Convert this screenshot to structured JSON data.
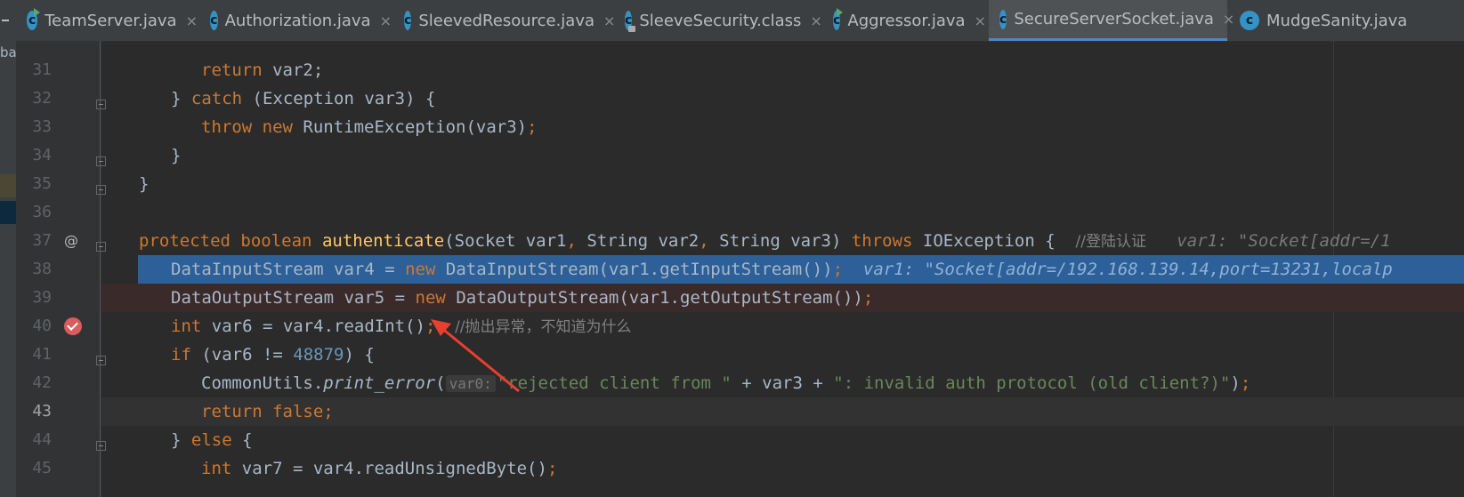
{
  "sidebar": {
    "partial_label": "ba"
  },
  "tabs": [
    {
      "label": "TeamServer.java",
      "icon": "class-run-icon",
      "close": "×"
    },
    {
      "label": "Authorization.java",
      "icon": "class-icon",
      "close": "×"
    },
    {
      "label": "SleevedResource.java",
      "icon": "class-icon",
      "close": "×"
    },
    {
      "label": "SleeveSecurity.class",
      "icon": "class-locked-icon",
      "close": "×"
    },
    {
      "label": "Aggressor.java",
      "icon": "class-run-icon",
      "close": "×"
    },
    {
      "label": "SecureServerSocket.java",
      "icon": "class-icon",
      "close": "×",
      "active": true
    },
    {
      "label": "MudgeSanity.java",
      "icon": "class-icon",
      "close": ""
    }
  ],
  "editor": {
    "lines": [
      {
        "n": "31"
      },
      {
        "n": "32"
      },
      {
        "n": "33"
      },
      {
        "n": "34"
      },
      {
        "n": "35"
      },
      {
        "n": "36"
      },
      {
        "n": "37"
      },
      {
        "n": "38"
      },
      {
        "n": "39"
      },
      {
        "n": "40"
      },
      {
        "n": "41"
      },
      {
        "n": "42"
      },
      {
        "n": "43"
      },
      {
        "n": "44"
      },
      {
        "n": "45"
      }
    ],
    "code": {
      "l31_ret": "return",
      "l31_var": " var2;",
      "l32_open": "} ",
      "l32_catch": "catch",
      "l32_rest": " (Exception var3) {",
      "l33_throw": "throw",
      "l33_new": "new",
      "l33_rest": " RuntimeException(var3)",
      "l33_semi": ";",
      "l34": "}",
      "l35": "}",
      "l37_prot": "protected",
      "l37_bool": "boolean",
      "l37_fn": "authenticate",
      "l37_params1": "(Socket var1",
      "l37_c1": ",",
      "l37_params2": " String var2",
      "l37_c2": ",",
      "l37_params3": " String var3) ",
      "l37_throws": "throws",
      "l37_exc": " IOException {  ",
      "l37_cmt": "//登陆认证",
      "l37_hint": "   var1: \"Socket[addr=/1",
      "l38_a": "DataInputStream var4 = ",
      "l38_new": "new",
      "l38_b": " DataInputStream(var1.getInputStream())",
      "l38_semi": ";",
      "l38_hint": "  var1: \"Socket[addr=/192.168.139.14,port=13231,localp",
      "l39_a": "DataOutputStream var5 = ",
      "l39_new": "new",
      "l39_b": " DataOutputStream(var1.getOutputStream())",
      "l39_semi": ";",
      "l40_int": "int",
      "l40_a": " var6 = var4.readInt()",
      "l40_semi": ";",
      "l40_cmt": "    //抛出异常，不知道为什么",
      "l41_if": "if",
      "l41_a": " (var6 != ",
      "l41_num": "48879",
      "l41_b": ") {",
      "l42_a": "CommonUtils.",
      "l42_fn": "print_error",
      "l42_paren": "(",
      "l42_hint": "var0:",
      "l42_str1": "\"rejected client from \"",
      "l42_b": " + var3 + ",
      "l42_str2": "\": invalid auth protocol (old client?)\"",
      "l42_c": ")",
      "l42_semi": ";",
      "l43_ret": "return",
      "l43_false": " false",
      "l43_semi": ";",
      "l44_a": "} ",
      "l44_else": "else",
      "l44_b": " {",
      "l45_int": "int",
      "l45_a": " var7 = var4.readUnsignedByte()",
      "l45_semi": ";"
    }
  },
  "colors": {
    "background": "#2b2b2b",
    "keyword": "#cc7832",
    "execution_line": "#2d6099",
    "breakpoint_line": "#3b2a2a",
    "annotation_arrow": "#e8402e"
  }
}
